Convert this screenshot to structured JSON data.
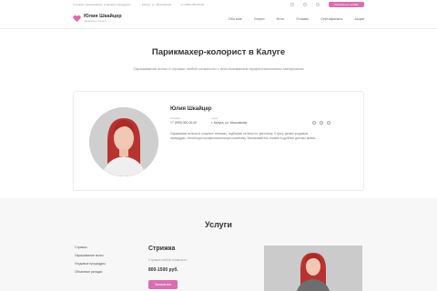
{
  "topbar": {
    "items": [
      "Стрижка, окрашивание, уходовые процедуры",
      "г. Калуга, ул. Московская",
      "+7 (999) 000-00-00"
    ],
    "cta_label": "Записаться онлайн",
    "icons": [
      "vk-icon",
      "instagram-icon",
      "telegram-icon",
      "whatsapp-icon"
    ]
  },
  "header": {
    "logo_name": "Юлия Шкайцер",
    "logo_sub": "парикмахер-колорист",
    "nav": [
      "Обо мне",
      "Услуги",
      "Фото",
      "Отзывы",
      "Сертификаты",
      "Акции"
    ]
  },
  "hero": {
    "title": "Парикмахер-колорист в Калуге",
    "subtitle": "Окрашивание волос и стрижки любой сложности с использованием профессиональных материалов"
  },
  "profile": {
    "name": "Юлия Шкайцер",
    "fields": [
      {
        "label": "Телефон",
        "value": "+7 (999) 000-00-00"
      },
      {
        "label": "Адрес",
        "value": "г. Калуга, ул. Московская"
      }
    ],
    "description": "Окрашиваю волосы в сложных техниках, подбираю оттенок по цветотипу. Стригу, делаю уходовые процедуры. Использую профессиональную косметику. Записывайтесь онлайн в удобное для вас время."
  },
  "services": {
    "title": "Услуги",
    "list": [
      "Стрижка",
      "Окрашивание волос",
      "Уходовые процедуры",
      "Объемные укладки"
    ],
    "current": {
      "name": "Стрижка",
      "desc": "Стрижка любой сложности",
      "price": "800-1500 руб.",
      "button": "Записаться"
    }
  },
  "colors": {
    "accent": "#d86fb0",
    "logo": "#e06aa8"
  }
}
